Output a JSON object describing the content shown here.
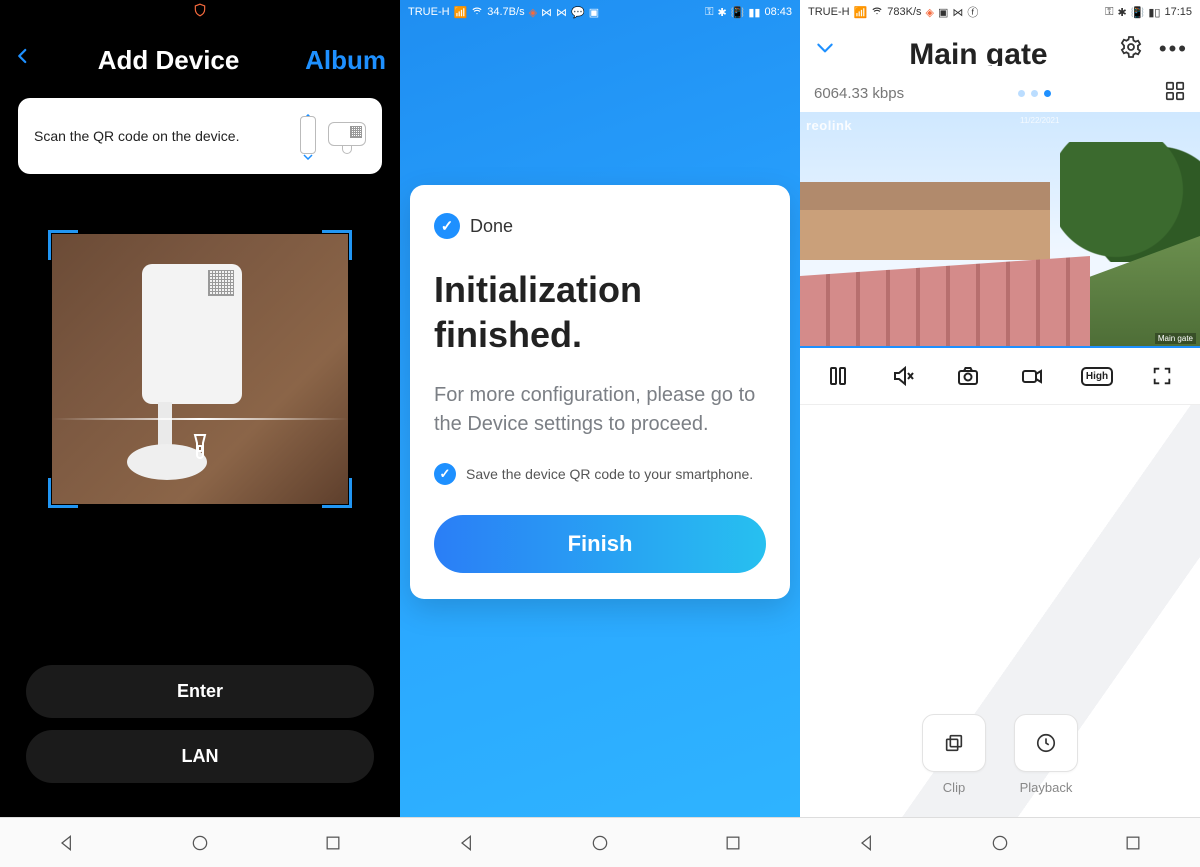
{
  "screen1": {
    "title": "Add Device",
    "album": "Album",
    "tip": "Scan the QR code on the device.",
    "enter": "Enter",
    "lan": "LAN"
  },
  "screen2": {
    "status": {
      "carrier": "TRUE-H",
      "speed": "34.7B/s",
      "time": "08:43"
    },
    "done": "Done",
    "heading": "Initialization finished.",
    "sub": "For more configuration, please go to the Device settings to proceed.",
    "saveqr": "Save the device QR code to your smartphone.",
    "finish": "Finish"
  },
  "screen3": {
    "status": {
      "carrier": "TRUE-H",
      "speed": "783K/s",
      "time": "17:15"
    },
    "title": "Main gate",
    "bitrate": "6064.33 kbps",
    "quality": "High",
    "watermark": "reolink",
    "camlabel": "Main gate",
    "clip": "Clip",
    "playback": "Playback"
  }
}
